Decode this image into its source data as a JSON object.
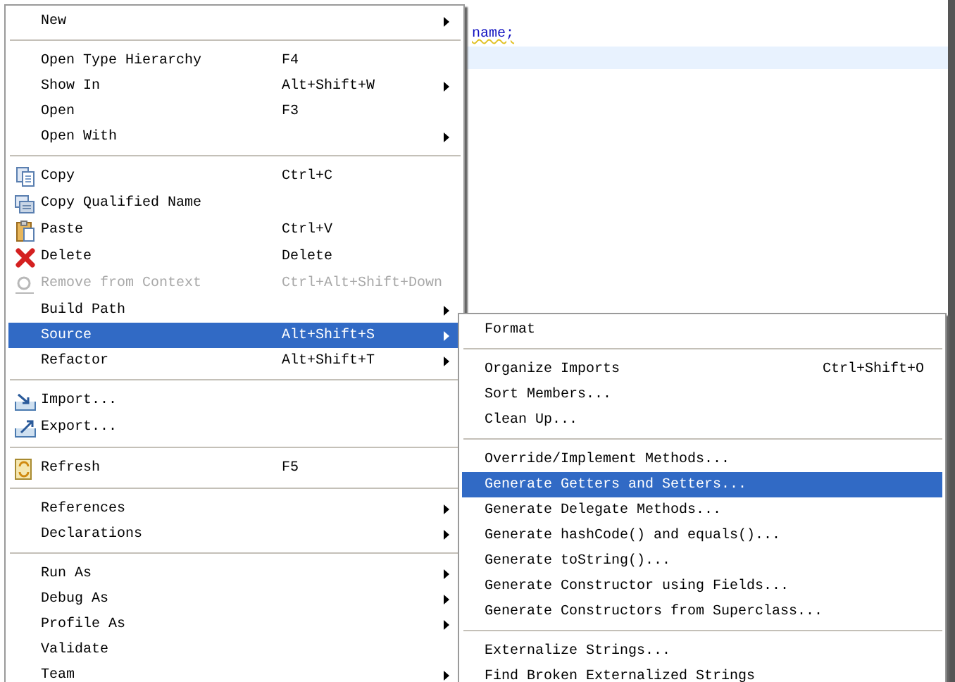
{
  "editor": {
    "code_line": "name;"
  },
  "context_menu": {
    "items": [
      {
        "kind": "item",
        "label": "New",
        "submenu": true,
        "selected": false,
        "disabled": false
      },
      {
        "kind": "separator"
      },
      {
        "kind": "item",
        "label": "Open Type Hierarchy",
        "shortcut": "F4",
        "submenu": false,
        "selected": false,
        "disabled": false
      },
      {
        "kind": "item",
        "label": "Show In",
        "shortcut": "Alt+Shift+W",
        "submenu": true,
        "selected": false,
        "disabled": false
      },
      {
        "kind": "item",
        "label": "Open",
        "shortcut": "F3",
        "submenu": false,
        "selected": false,
        "disabled": false
      },
      {
        "kind": "item",
        "label": "Open With",
        "submenu": true,
        "selected": false,
        "disabled": false
      },
      {
        "kind": "separator"
      },
      {
        "kind": "item",
        "label": "Copy",
        "shortcut": "Ctrl+C",
        "submenu": false,
        "selected": false,
        "disabled": false
      },
      {
        "kind": "item",
        "label": "Copy Qualified Name",
        "submenu": false,
        "selected": false,
        "disabled": false
      },
      {
        "kind": "item",
        "label": "Paste",
        "shortcut": "Ctrl+V",
        "submenu": false,
        "selected": false,
        "disabled": false
      },
      {
        "kind": "item",
        "label": "Delete",
        "shortcut": "Delete",
        "submenu": false,
        "selected": false,
        "disabled": false
      },
      {
        "kind": "item",
        "label": "Remove from Context",
        "shortcut": "Ctrl+Alt+Shift+Down",
        "submenu": false,
        "selected": false,
        "disabled": true
      },
      {
        "kind": "item",
        "label": "Build Path",
        "submenu": true,
        "selected": false,
        "disabled": false
      },
      {
        "kind": "item",
        "label": "Source",
        "shortcut": "Alt+Shift+S",
        "submenu": true,
        "selected": true,
        "disabled": false
      },
      {
        "kind": "item",
        "label": "Refactor",
        "shortcut": "Alt+Shift+T",
        "submenu": true,
        "selected": false,
        "disabled": false
      },
      {
        "kind": "separator"
      },
      {
        "kind": "item",
        "label": "Import...",
        "submenu": false,
        "selected": false,
        "disabled": false
      },
      {
        "kind": "item",
        "label": "Export...",
        "submenu": false,
        "selected": false,
        "disabled": false
      },
      {
        "kind": "separator"
      },
      {
        "kind": "item",
        "label": "Refresh",
        "shortcut": "F5",
        "submenu": false,
        "selected": false,
        "disabled": false
      },
      {
        "kind": "separator"
      },
      {
        "kind": "item",
        "label": "References",
        "submenu": true,
        "selected": false,
        "disabled": false
      },
      {
        "kind": "item",
        "label": "Declarations",
        "submenu": true,
        "selected": false,
        "disabled": false
      },
      {
        "kind": "separator"
      },
      {
        "kind": "item",
        "label": "Run As",
        "submenu": true,
        "selected": false,
        "disabled": false
      },
      {
        "kind": "item",
        "label": "Debug As",
        "submenu": true,
        "selected": false,
        "disabled": false
      },
      {
        "kind": "item",
        "label": "Profile As",
        "submenu": true,
        "selected": false,
        "disabled": false
      },
      {
        "kind": "item",
        "label": "Validate",
        "submenu": false,
        "selected": false,
        "disabled": false
      },
      {
        "kind": "item",
        "label": "Team",
        "submenu": true,
        "selected": false,
        "disabled": false
      }
    ]
  },
  "source_submenu": {
    "items": [
      {
        "kind": "item",
        "label": "Format",
        "submenu": false,
        "selected": false,
        "disabled": false
      },
      {
        "kind": "separator"
      },
      {
        "kind": "item",
        "label": "Organize Imports",
        "shortcut": "Ctrl+Shift+O",
        "submenu": false,
        "selected": false,
        "disabled": false
      },
      {
        "kind": "item",
        "label": "Sort Members...",
        "submenu": false,
        "selected": false,
        "disabled": false
      },
      {
        "kind": "item",
        "label": "Clean Up...",
        "submenu": false,
        "selected": false,
        "disabled": false
      },
      {
        "kind": "separator"
      },
      {
        "kind": "item",
        "label": "Override/Implement Methods...",
        "submenu": false,
        "selected": false,
        "disabled": false
      },
      {
        "kind": "item",
        "label": "Generate Getters and Setters...",
        "submenu": false,
        "selected": true,
        "disabled": false
      },
      {
        "kind": "item",
        "label": "Generate Delegate Methods...",
        "submenu": false,
        "selected": false,
        "disabled": false
      },
      {
        "kind": "item",
        "label": "Generate hashCode() and equals()...",
        "submenu": false,
        "selected": false,
        "disabled": false
      },
      {
        "kind": "item",
        "label": "Generate toString()...",
        "submenu": false,
        "selected": false,
        "disabled": false
      },
      {
        "kind": "item",
        "label": "Generate Constructor using Fields...",
        "submenu": false,
        "selected": false,
        "disabled": false
      },
      {
        "kind": "item",
        "label": "Generate Constructors from Superclass...",
        "submenu": false,
        "selected": false,
        "disabled": false
      },
      {
        "kind": "separator"
      },
      {
        "kind": "item",
        "label": "Externalize Strings...",
        "submenu": false,
        "selected": false,
        "disabled": false
      },
      {
        "kind": "item",
        "label": "Find Broken Externalized Strings",
        "submenu": false,
        "selected": false,
        "disabled": false
      }
    ]
  }
}
